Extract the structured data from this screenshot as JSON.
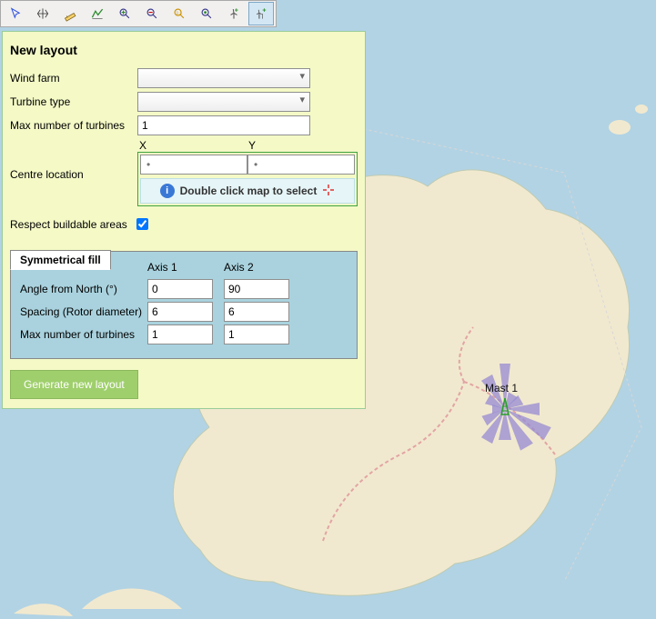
{
  "toolbar": {
    "buttons": [
      {
        "name": "pointer-icon"
      },
      {
        "name": "pan-icon"
      },
      {
        "name": "ruler-icon"
      },
      {
        "name": "profile-icon"
      },
      {
        "name": "zoom-in-icon"
      },
      {
        "name": "zoom-out-icon"
      },
      {
        "name": "zoom-reset-icon"
      },
      {
        "name": "zoom-extent-icon"
      },
      {
        "name": "turbine-icon"
      },
      {
        "name": "turbine-add-icon"
      }
    ],
    "active_index": 9
  },
  "panel": {
    "title": "New layout",
    "labels": {
      "wind_farm": "Wind farm",
      "turbine_type": "Turbine type",
      "max_turbines": "Max number of turbines",
      "x": "X",
      "y": "Y",
      "centre_location": "Centre location",
      "info_text": "Double click map to select",
      "respect_buildable": "Respect buildable areas"
    },
    "values": {
      "wind_farm": "",
      "turbine_type": "",
      "max_turbines": "1",
      "x_placeholder": "•",
      "y_placeholder": "•",
      "respect_buildable": true
    },
    "tab": {
      "title": "Symmetrical fill",
      "headers": {
        "axis1": "Axis 1",
        "axis2": "Axis 2"
      },
      "rows": {
        "angle": {
          "label": "Angle from North (°)",
          "axis1": "0",
          "axis2": "90"
        },
        "spacing": {
          "label": "Spacing (Rotor diameter)",
          "axis1": "6",
          "axis2": "6"
        },
        "max": {
          "label": "Max number of turbines",
          "axis1": "1",
          "axis2": "1"
        }
      }
    },
    "generate_button": "Generate new layout"
  },
  "map": {
    "mast_label": "Mast 1",
    "colors": {
      "sea": "#b2d3e4",
      "land": "#f1e9cf",
      "rose": "#968ad1",
      "road": "#e2a4a4",
      "mast": "#58c070"
    }
  }
}
